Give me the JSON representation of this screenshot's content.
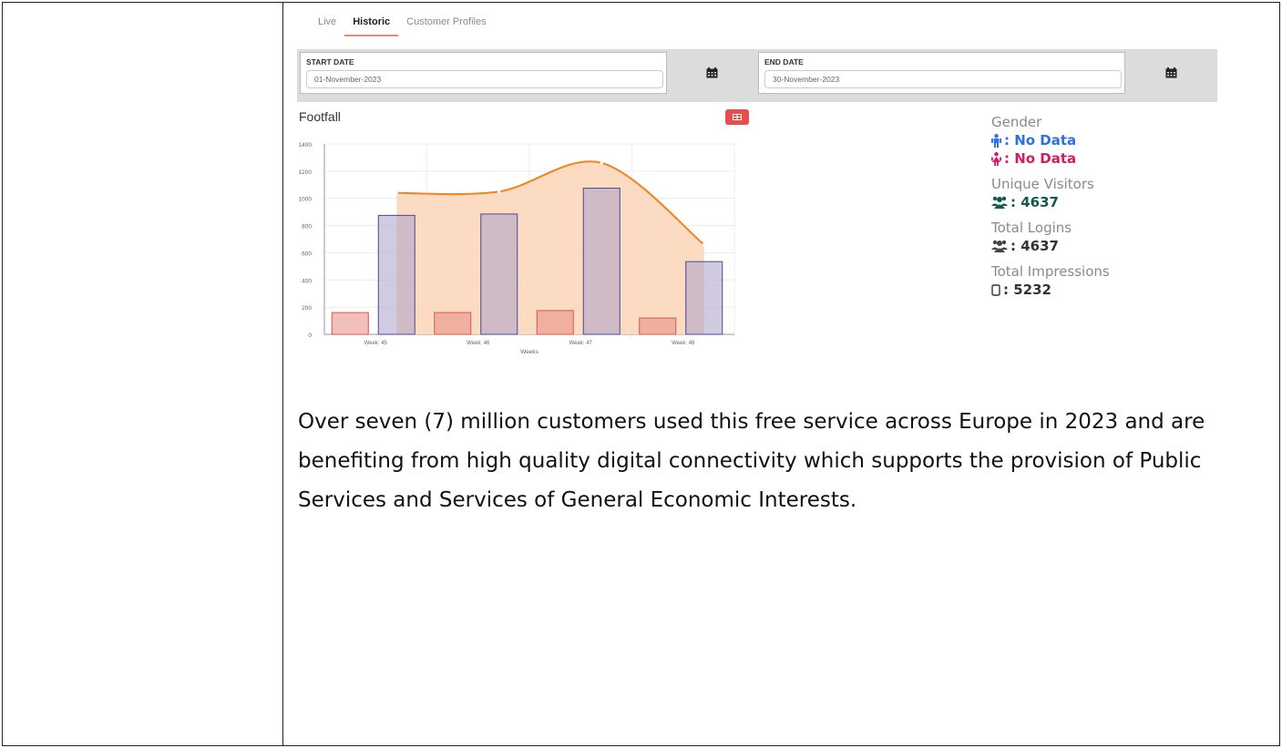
{
  "tabs": [
    {
      "label": "Live",
      "active": false
    },
    {
      "label": "Historic",
      "active": true
    },
    {
      "label": "Customer Profiles",
      "active": false
    }
  ],
  "start_date": {
    "label": "START DATE",
    "value": "01-November-2023"
  },
  "end_date": {
    "label": "END DATE",
    "value": "30-November-2023"
  },
  "footfall": {
    "title": "Footfall"
  },
  "chart_data": {
    "type": "bar",
    "categories": [
      "Week: 45",
      "Week: 46",
      "Week: 47",
      "Week: 48"
    ],
    "series": [
      {
        "type": "bar",
        "values": [
          160,
          160,
          175,
          120
        ],
        "color": "#e8a58f"
      },
      {
        "type": "bar",
        "values": [
          875,
          885,
          1075,
          535
        ],
        "color": "#b9b7d3"
      },
      {
        "type": "area",
        "values": [
          1040,
          1050,
          1260,
          660
        ],
        "color": "#f0841e"
      }
    ],
    "xlabel": "Weeks",
    "ylabel": "",
    "ylim": [
      0,
      1400
    ],
    "yticks": [
      0,
      200,
      400,
      600,
      800,
      1000,
      1200,
      1400
    ],
    "grid": true
  },
  "stats": {
    "gender_label": "Gender",
    "male": ": No Data",
    "female": ": No Data",
    "unique_label": "Unique Visitors",
    "unique_value": ": 4637",
    "logins_label": "Total Logins",
    "logins_value": ": 4637",
    "impressions_label": "Total Impressions",
    "impressions_value": ": 5232"
  },
  "paragraph": "Over seven (7) million customers used this free service across Europe in 2023 and are benefiting from high quality digital connectivity which supports the provision of Public Services and Services of General Economic Interests."
}
